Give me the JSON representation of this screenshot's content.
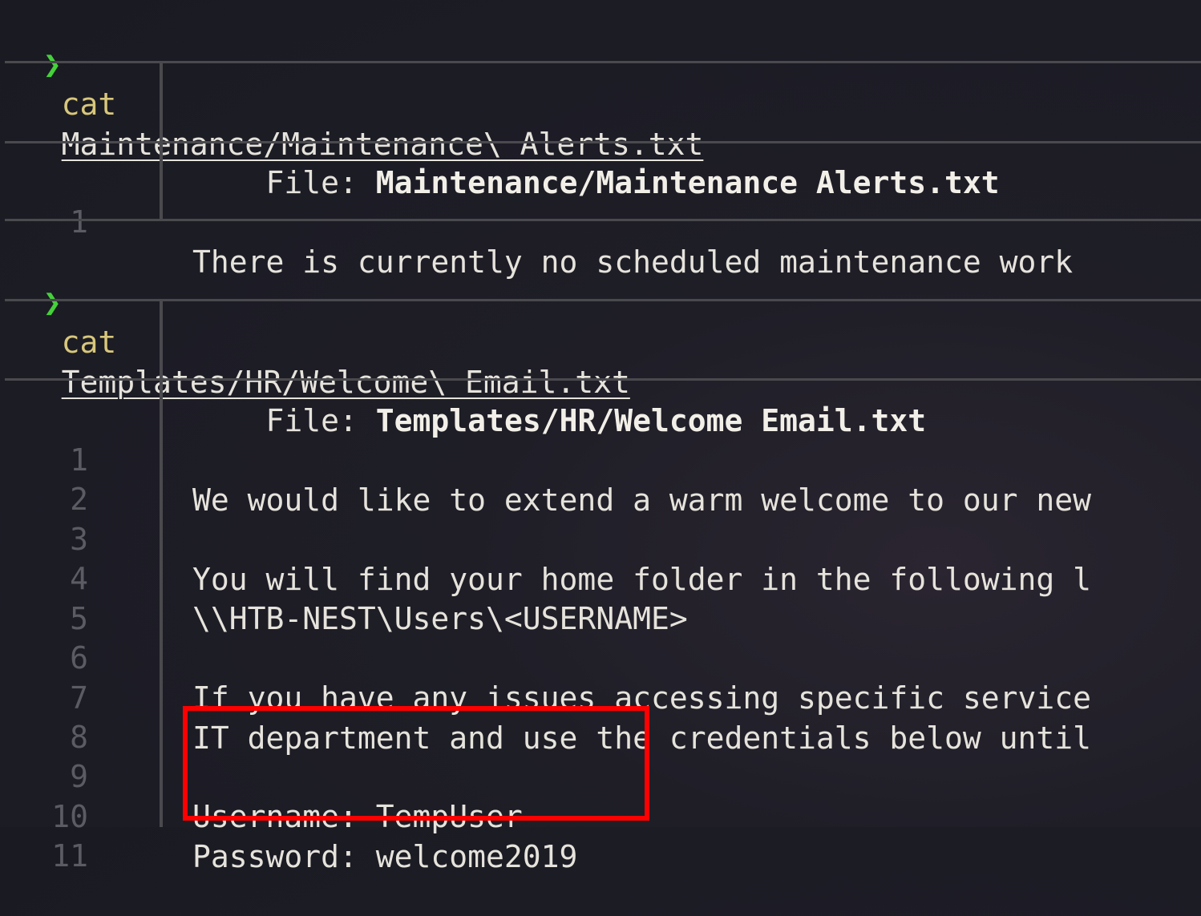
{
  "terminal": {
    "prompt_symbol": "❯",
    "blocks": [
      {
        "command": "cat",
        "argument": "Maintenance/Maintenance\\ Alerts.txt",
        "file_label": "File: ",
        "file_name": "Maintenance/Maintenance Alerts.txt",
        "lines": [
          {
            "n": "1",
            "text": "There is currently no scheduled maintenance work"
          }
        ]
      },
      {
        "command": "cat",
        "argument": "Templates/HR/Welcome\\ Email.txt",
        "file_label": "File: ",
        "file_name": "Templates/HR/Welcome Email.txt",
        "lines": [
          {
            "n": "1",
            "text": "We would like to extend a warm welcome to our new"
          },
          {
            "n": "2",
            "text": ""
          },
          {
            "n": "3",
            "text": "You will find your home folder in the following l"
          },
          {
            "n": "4",
            "text": "\\\\HTB-NEST\\Users\\<USERNAME>"
          },
          {
            "n": "5",
            "text": ""
          },
          {
            "n": "6",
            "text": "If you have any issues accessing specific service"
          },
          {
            "n": "7",
            "text": "IT department and use the credentials below until"
          },
          {
            "n": "8",
            "text": ""
          },
          {
            "n": "9",
            "text": "Username: TempUser"
          },
          {
            "n": "10",
            "text": "Password: welcome2019"
          },
          {
            "n": "11",
            "text": ""
          }
        ]
      }
    ]
  },
  "colors": {
    "background": "#1c1c25",
    "prompt": "#45d13a",
    "command": "#d8c77b",
    "line_number": "#5b5b63",
    "highlight_box": "#ff0000"
  }
}
